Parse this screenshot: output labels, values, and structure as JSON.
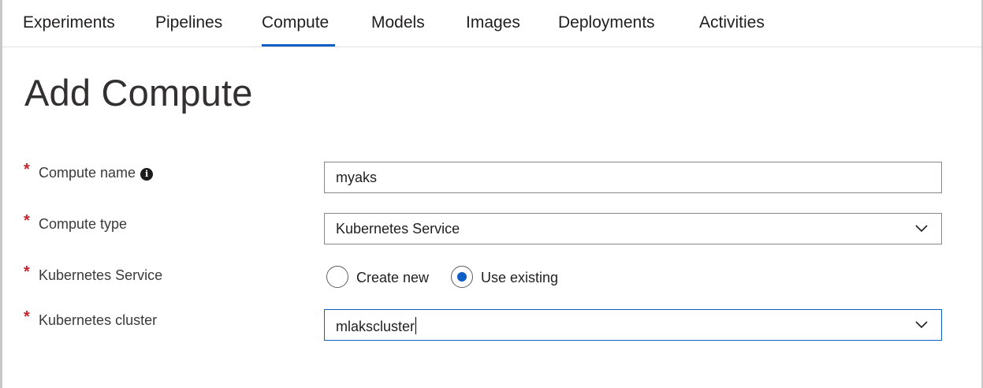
{
  "tabs": [
    {
      "label": "Experiments"
    },
    {
      "label": "Pipelines"
    },
    {
      "label": "Compute",
      "active": true
    },
    {
      "label": "Models"
    },
    {
      "label": "Images"
    },
    {
      "label": "Deployments"
    },
    {
      "label": "Activities"
    }
  ],
  "page": {
    "title": "Add Compute"
  },
  "form": {
    "required_marker": "*",
    "compute_name": {
      "label": "Compute name",
      "info_icon": "info-icon",
      "value": "myaks"
    },
    "compute_type": {
      "label": "Compute type",
      "value": "Kubernetes Service",
      "icon": "chevron-down-icon"
    },
    "kubernetes_service": {
      "label": "Kubernetes Service",
      "options": [
        {
          "label": "Create new",
          "selected": false
        },
        {
          "label": "Use existing",
          "selected": true
        }
      ]
    },
    "kubernetes_cluster": {
      "label": "Kubernetes cluster",
      "value": "mlakscluster",
      "icon": "chevron-down-icon",
      "focused": true
    }
  },
  "colors": {
    "accent": "#0f5fc5",
    "required": "#c4262e",
    "border": "#8a8886"
  }
}
